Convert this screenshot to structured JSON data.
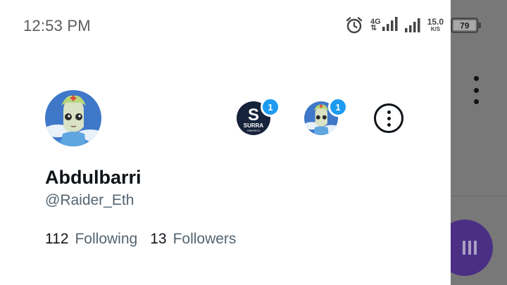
{
  "status_bar": {
    "time": "12:53 PM",
    "network_type": "4G",
    "network_arrows": "⇅",
    "speed_value": "15.0",
    "speed_unit": "K/S",
    "battery": "79",
    "icons": [
      "alarm-icon",
      "signal-icon",
      "signal-icon",
      "battery-icon"
    ]
  },
  "profile": {
    "display_name": "Abdulbarri",
    "handle": "@Raider_Eth",
    "following_count": "112",
    "following_label": "Following",
    "followers_count": "13",
    "followers_label": "Followers"
  },
  "accounts": [
    {
      "name": "SURRA",
      "sub": "GRAPHICS",
      "badge": "1"
    },
    {
      "name": "",
      "sub": "",
      "badge": "1"
    }
  ],
  "colors": {
    "accent": "#1d9bf0",
    "text_primary": "#0f1419",
    "text_secondary": "#536471",
    "fab": "#4b2f85",
    "scrim": "#787878"
  }
}
